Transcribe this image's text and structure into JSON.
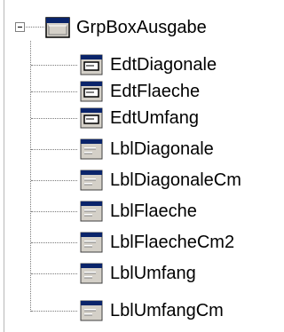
{
  "tree": {
    "root": {
      "label": "GrpBoxAusgabe",
      "expanded": true,
      "icon": "groupbox-icon"
    },
    "children": [
      {
        "label": "EdtDiagonale",
        "icon": "edit-field-icon"
      },
      {
        "label": "EdtFlaeche",
        "icon": "edit-field-icon"
      },
      {
        "label": "EdtUmfang",
        "icon": "edit-field-icon"
      },
      {
        "label": "LblDiagonale",
        "icon": "label-icon"
      },
      {
        "label": "LblDiagonaleCm",
        "icon": "label-icon"
      },
      {
        "label": "LblFlaeche",
        "icon": "label-icon"
      },
      {
        "label": "LblFlaecheCm2",
        "icon": "label-icon"
      },
      {
        "label": "LblUmfang",
        "icon": "label-icon"
      },
      {
        "label": "LblUmfangCm",
        "icon": "label-icon"
      }
    ]
  },
  "colors": {
    "window_blue": "#0a246a",
    "face_gray": "#d4d0c8",
    "connector": "#7a7a7a"
  }
}
